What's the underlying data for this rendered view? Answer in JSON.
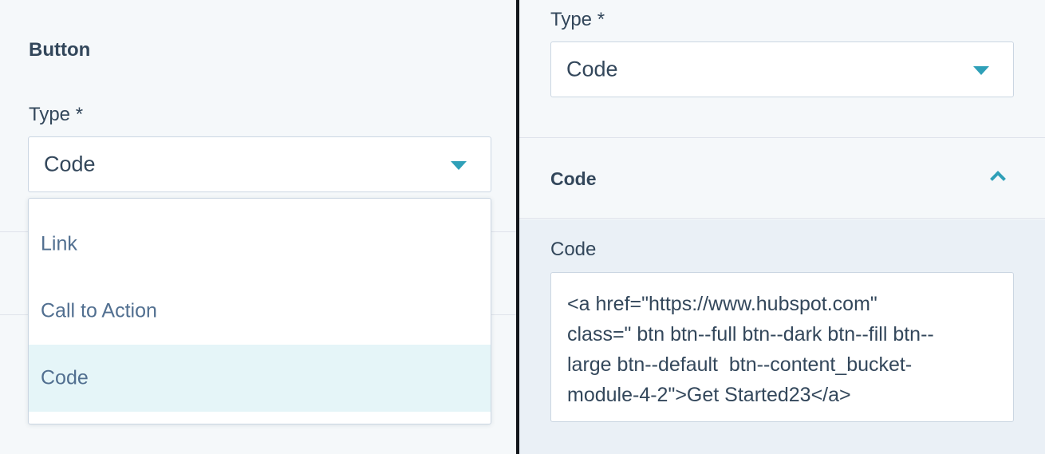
{
  "left": {
    "section_title": "Button",
    "type_label": "Type *",
    "type_value": "Code",
    "options": [
      {
        "label": "Link",
        "selected": false
      },
      {
        "label": "Call to Action",
        "selected": false
      },
      {
        "label": "Code",
        "selected": true
      }
    ]
  },
  "right": {
    "type_label": "Type *",
    "type_value": "Code",
    "section_title": "Code",
    "code_label": "Code",
    "code_lines": [
      "<a href=\"https://www.hubspot.com\"",
      "class=\" btn btn--full btn--dark btn--fill btn--",
      "large btn--default  btn--content_bucket-",
      "module-4-2\">Get Started23</a>"
    ]
  },
  "colors": {
    "accent": "#2fa0b8",
    "panel_bg": "#f5f8fa",
    "selected_bg": "#e5f5f8",
    "divider": "#12161b"
  },
  "icons": [
    "caret-down-icon",
    "chevron-up-icon"
  ]
}
